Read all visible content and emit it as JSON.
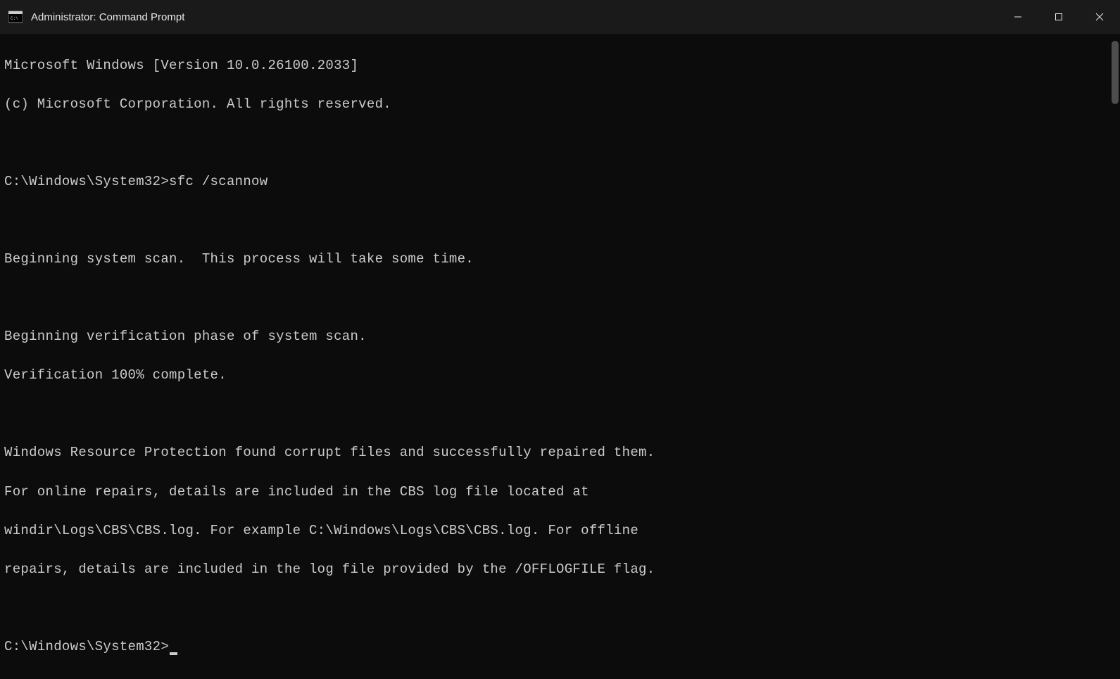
{
  "window": {
    "title": "Administrator: Command Prompt"
  },
  "terminal": {
    "lines": [
      "Microsoft Windows [Version 10.0.26100.2033]",
      "(c) Microsoft Corporation. All rights reserved.",
      "",
      "C:\\Windows\\System32>sfc /scannow",
      "",
      "Beginning system scan.  This process will take some time.",
      "",
      "Beginning verification phase of system scan.",
      "Verification 100% complete.",
      "",
      "Windows Resource Protection found corrupt files and successfully repaired them.",
      "For online repairs, details are included in the CBS log file located at",
      "windir\\Logs\\CBS\\CBS.log. For example C:\\Windows\\Logs\\CBS\\CBS.log. For offline",
      "repairs, details are included in the log file provided by the /OFFLOGFILE flag.",
      ""
    ],
    "current_prompt": "C:\\Windows\\System32>"
  }
}
